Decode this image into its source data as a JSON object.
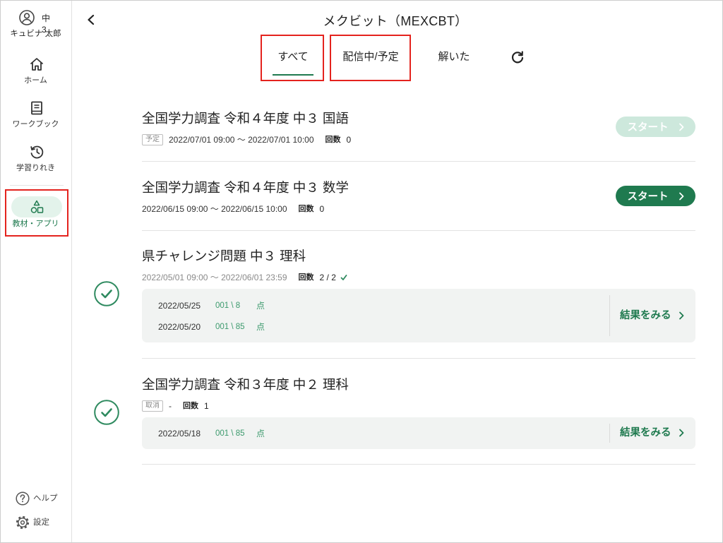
{
  "sidebar": {
    "user": {
      "grade": "中3",
      "name": "キュビナ 太郎",
      "icon": "user-circle-icon"
    },
    "nav": [
      {
        "label": "ホーム",
        "icon": "home-icon",
        "active": false
      },
      {
        "label": "ワークブック",
        "icon": "book-icon",
        "active": false
      },
      {
        "label": "学習りれき",
        "icon": "history-icon",
        "active": false
      },
      {
        "label": "教材・アプリ",
        "icon": "shapes-icon",
        "active": true
      }
    ],
    "footer": [
      {
        "label": "ヘルプ",
        "icon": "help-icon"
      },
      {
        "label": "設定",
        "icon": "gear-icon"
      }
    ]
  },
  "header": {
    "title": "メクビット（MEXCBT）",
    "back_icon": "chevron-left-icon",
    "refresh_icon": "refresh-icon"
  },
  "tabs": [
    {
      "label": "すべて",
      "active": true
    },
    {
      "label": "配信中/予定",
      "active": false
    },
    {
      "label": "解いた",
      "active": false
    }
  ],
  "items": [
    {
      "title": "全国学力調査 令和４年度 中３ 国語",
      "badge": "予定",
      "period": "2022/07/01 09:00 ～ 2022/07/01 10:00",
      "count_label": "回数",
      "count": "0",
      "action_label": "スタート",
      "action_enabled": false
    },
    {
      "title": "全国学力調査 令和４年度 中３ 数学",
      "period": "2022/06/15 09:00 ～ 2022/06/15 10:00",
      "count_label": "回数",
      "count": "0",
      "action_label": "スタート",
      "action_enabled": true
    },
    {
      "title": "県チャレンジ問題 中３ 理科",
      "period": "2022/05/01 09:00 ～ 2022/06/01 23:59",
      "count_label": "回数",
      "count": "2 / 2",
      "completed": true,
      "results": [
        {
          "date": "2022/05/25",
          "score": "001 \\ 8",
          "unit": "点"
        },
        {
          "date": "2022/05/20",
          "score": "001 \\ 85",
          "unit": "点"
        }
      ],
      "results_link": "結果をみる"
    },
    {
      "title": "全国学力調査 令和３年度 中２ 理科",
      "badge": "取消",
      "period": "-",
      "count_label": "回数",
      "count": "1",
      "completed": true,
      "results": [
        {
          "date": "2022/05/18",
          "score": "001 \\ 85",
          "unit": "点"
        }
      ],
      "results_link": "結果をみる"
    }
  ],
  "colors": {
    "accent": "#1f7a4f",
    "accent_pale": "#cde8dc",
    "active_nav_bg": "#e3f3eb",
    "score": "#3c9a6d",
    "highlight": "#e4231e"
  }
}
